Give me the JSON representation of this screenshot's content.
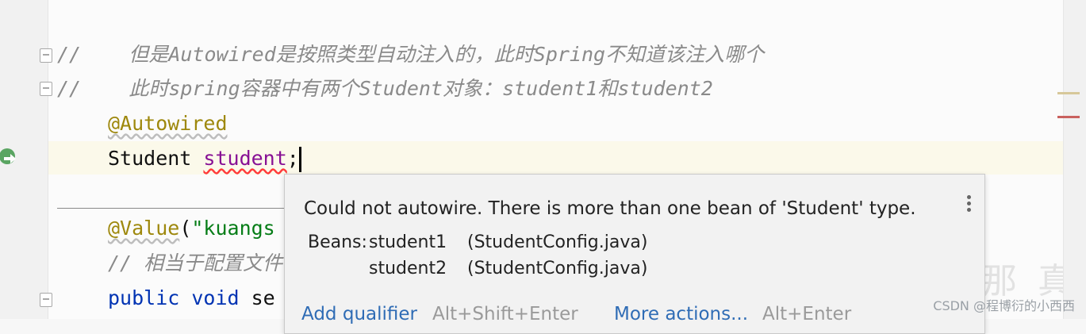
{
  "code": {
    "line1_prefix": "//",
    "line1_comment": "    但是Autowired是按照类型自动注入的，此时Spring不知道该注入哪个",
    "line2_prefix": "//",
    "line2_comment": "    此时spring容器中有两个Student对象：student1和student2",
    "line3_annotation": "@Autowired",
    "line4_type": "Student ",
    "line4_field": "student",
    "line4_semicolon": ";",
    "line6_annotation": "@Value",
    "line6_paren": "(",
    "line6_string": "\"kuangs",
    "line7_comment": "// 相当于配置文件",
    "line8_kw1": "public ",
    "line8_kw2": "void ",
    "line8_name": "se"
  },
  "popup": {
    "message": "Could not autowire. There is more than one bean of 'Student' type.",
    "beans_label": "Beans:",
    "beans": [
      {
        "name": "student1",
        "source": "(StudentConfig.java)"
      },
      {
        "name": "student2",
        "source": "(StudentConfig.java)"
      }
    ],
    "actions": [
      {
        "label": "Add qualifier",
        "shortcut": "Alt+Shift+Enter"
      },
      {
        "label": "More actions...",
        "shortcut": "Alt+Enter"
      }
    ]
  },
  "watermark": "CSDN @程博衍的小西西",
  "background_text": "那 真",
  "colors": {
    "annotation": "#9e880d",
    "keyword": "#0033b3",
    "string": "#067d17",
    "field": "#871094",
    "link": "#2f6cb5"
  }
}
